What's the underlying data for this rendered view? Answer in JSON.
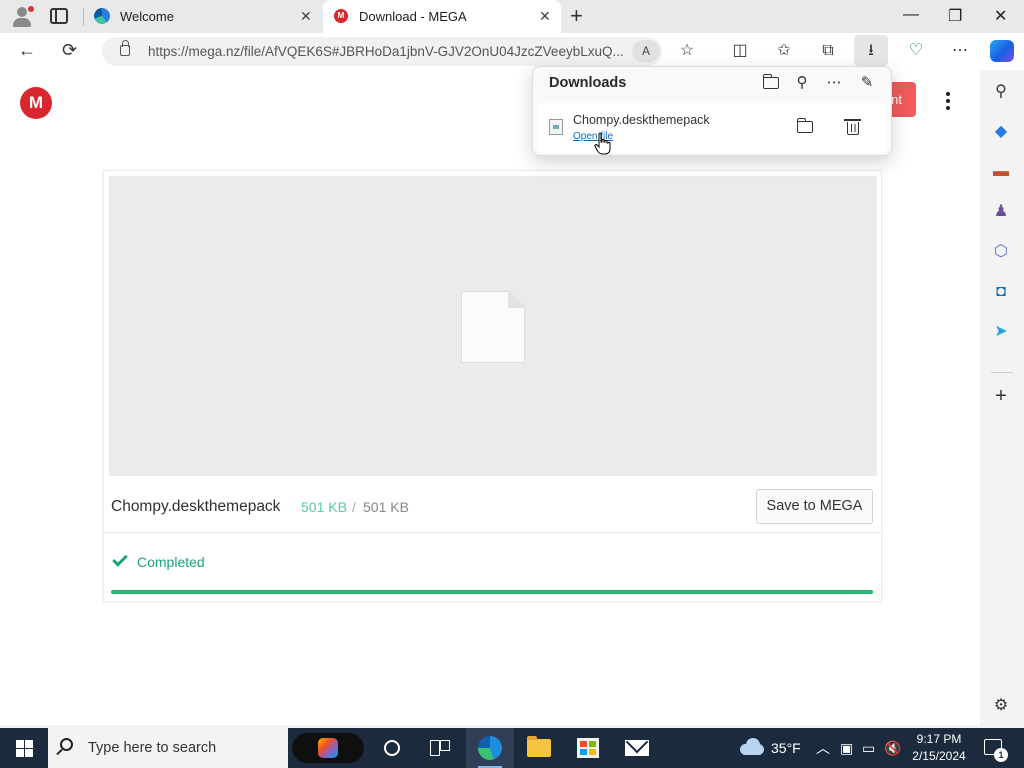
{
  "browser": {
    "tabs": [
      {
        "label": "Welcome",
        "favicon": "edge-icon",
        "active": false
      },
      {
        "label": "Download - MEGA",
        "favicon": "mega-icon",
        "active": true
      }
    ],
    "url": "https://mega.nz/file/AfVQEK6S#JBRHoDa1jbnV-GJV2OnU04JzcZVeeybLxuQ...",
    "read_aloud_label": "A",
    "window_controls": {
      "minimize": "—",
      "restore": "❐",
      "close": "✕"
    }
  },
  "downloads_panel": {
    "title": "Downloads",
    "items": [
      {
        "file_name": "Chompy.deskthemepack",
        "action_label": "Open file"
      }
    ]
  },
  "mega": {
    "logo_letter": "M",
    "signup_partial_label": "nt",
    "file_name": "Chompy.deskthemepack",
    "downloaded_size": "501 KB",
    "size_separator": "/",
    "total_size": "501 KB",
    "save_button_label": "Save to MEGA",
    "status_text": "Completed",
    "progress_percent": 100
  },
  "sidebar": {
    "items": [
      "search-icon",
      "tag-icon",
      "briefcase-icon",
      "chess-icon",
      "microsoft365-icon",
      "outlook-icon",
      "send-icon",
      "add-icon",
      "settings-icon"
    ]
  },
  "taskbar": {
    "search_placeholder": "Type here to search",
    "weather_temp": "35°F",
    "time": "9:17 PM",
    "date": "2/15/2024",
    "notification_count": "1"
  },
  "colors": {
    "mega_red": "#d9272e",
    "complete_green": "#1ba37b",
    "progress_green": "#2bb673",
    "taskbar_bg": "#1c2a3d"
  }
}
